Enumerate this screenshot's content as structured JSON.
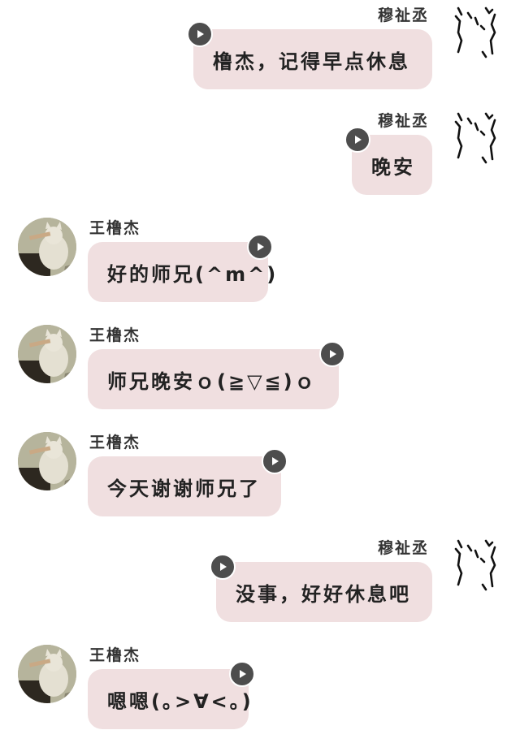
{
  "sender": "穆祉丞",
  "receiver": "王橹杰",
  "messages": [
    {
      "from": "right",
      "name": "穆祉丞",
      "text": "橹杰，记得早点休息",
      "avatar": "doodle-cat-icon"
    },
    {
      "from": "right",
      "name": "穆祉丞",
      "text": "晚安",
      "avatar": "doodle-cat-icon"
    },
    {
      "from": "left",
      "name": "王橹杰",
      "text": "好的师兄(^m^)",
      "avatar": "cat-photo-avatar"
    },
    {
      "from": "left",
      "name": "王橹杰",
      "text": "师兄晚安ｏ(≧▽≦)ｏ",
      "avatar": "cat-photo-avatar"
    },
    {
      "from": "left",
      "name": "王橹杰",
      "text": "今天谢谢师兄了",
      "avatar": "cat-photo-avatar"
    },
    {
      "from": "right",
      "name": "穆祉丞",
      "text": "没事，好好休息吧",
      "avatar": "doodle-cat-icon"
    },
    {
      "from": "left",
      "name": "王橹杰",
      "text": "嗯嗯(｡>∀<｡)",
      "avatar": "cat-photo-avatar"
    }
  ],
  "colors": {
    "bubble": "#f0dfe0",
    "play_button": "#4d4d4d",
    "background": "#ffffff"
  },
  "icons": {
    "play": "play-icon",
    "doodle": "doodle-cat-icon",
    "photo": "cat-photo-avatar"
  }
}
